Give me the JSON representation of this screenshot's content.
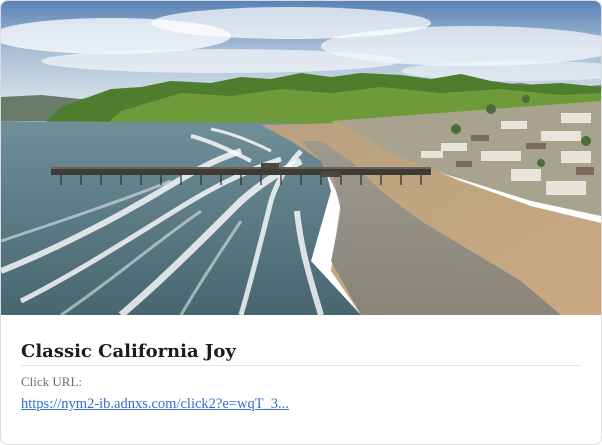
{
  "card": {
    "image_alt": "Aerial view of a coastal pier, beach and green hills",
    "title": "Classic California Joy",
    "click_url_label": "Click URL:",
    "click_url_text": "https://nym2-ib.adnxs.com/click2?e=wqT_3..."
  }
}
